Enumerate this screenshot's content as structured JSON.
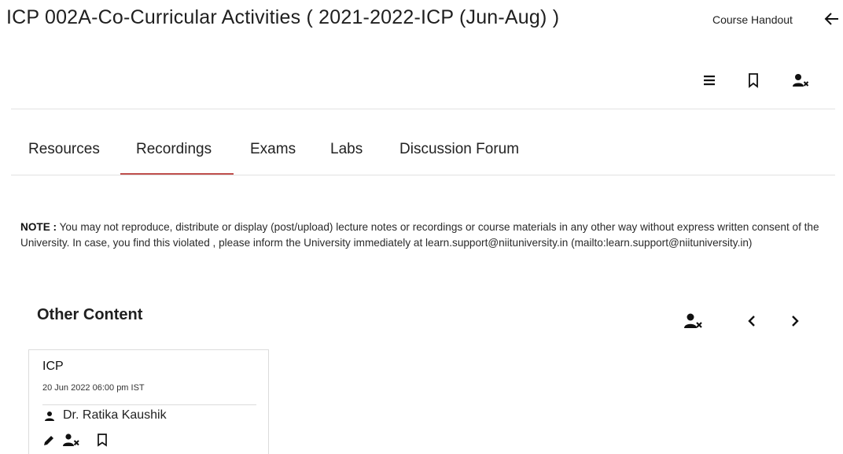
{
  "header": {
    "course_title": "ICP 002A-Co-Curricular Activities ( 2021-2022-ICP (Jun-Aug) )",
    "handout_label": "Course Handout",
    "back_icon": "arrow-left-icon"
  },
  "toolbar": {
    "icons": [
      "menu-icon",
      "bookmark-icon",
      "user-remove-icon"
    ]
  },
  "tabs": [
    {
      "label": "Resources",
      "active": false
    },
    {
      "label": "Recordings",
      "active": true
    },
    {
      "label": "Exams",
      "active": false
    },
    {
      "label": "Labs",
      "active": false
    },
    {
      "label": "Discussion Forum",
      "active": false
    }
  ],
  "note": {
    "prefix": "NOTE :",
    "text": "You may not reproduce, distribute or display (post/upload) lecture notes or recordings or course materials in any other way without express written consent of the University. In case, you find this violated , please inform the University immediately at learn.support@niituniversity.in (mailto:learn.support@niituniversity.in)"
  },
  "other_content": {
    "title": "Other Content",
    "controls": [
      "user-remove-icon",
      "chevron-left-icon",
      "chevron-right-icon"
    ],
    "items": [
      {
        "title": "ICP",
        "datetime": "20 Jun 2022 06:00 pm IST",
        "instructor": "Dr. Ratika Kaushik",
        "actions": [
          "edit-icon",
          "user-remove-icon",
          "bookmark-icon"
        ]
      }
    ]
  },
  "colors": {
    "accent_underline": "#c0504d",
    "divider": "#e2e2e2"
  }
}
